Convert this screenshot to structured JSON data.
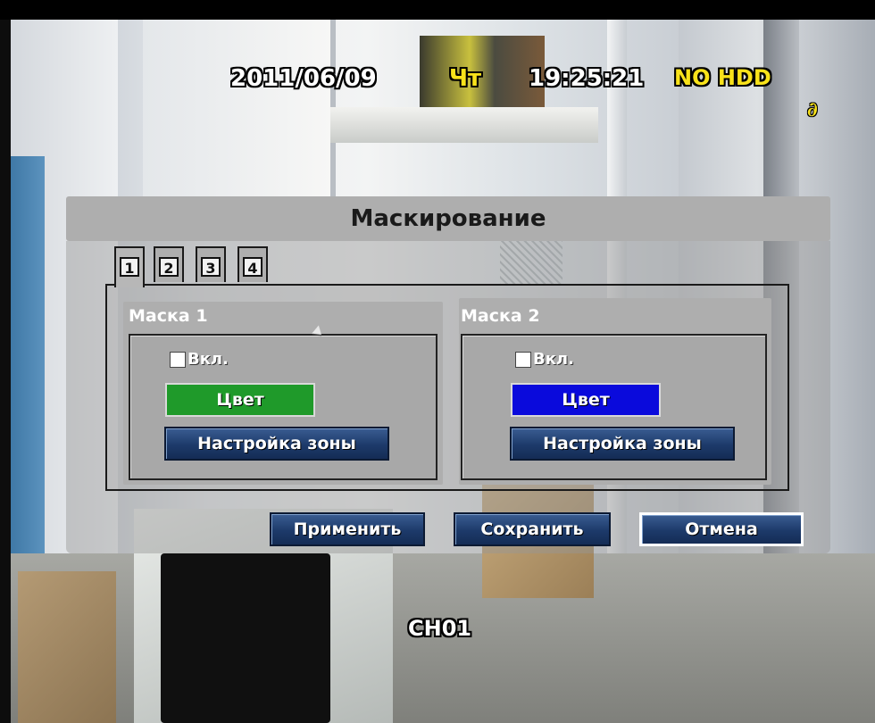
{
  "osd": {
    "date": "2011/06/09",
    "weekday": "Чт",
    "time": "19:25:21",
    "hdd_status": "NO HDD",
    "record_icon": "rec-mode-icon",
    "channel": "CH01"
  },
  "dialog": {
    "title": "Маскирование",
    "tabs": [
      "1",
      "2",
      "3",
      "4"
    ],
    "active_tab": "1"
  },
  "masks": [
    {
      "title": "Маска 1",
      "enable_label": "Вкл.",
      "enabled": false,
      "color_label": "Цвет",
      "color": "#1f9a2a",
      "zone_label": "Настройка зоны"
    },
    {
      "title": "Маска 2",
      "enable_label": "Вкл.",
      "enabled": false,
      "color_label": "Цвет",
      "color": "#0a0adc",
      "zone_label": "Настройка зоны"
    }
  ],
  "actions": {
    "apply": "Применить",
    "save": "Сохранить",
    "cancel": "Отмена",
    "focused": "cancel"
  },
  "colors": {
    "osd_yellow": "#f8e21a",
    "button_blue": "#1d3a6a",
    "dialog_gray": "#aeaeae"
  }
}
